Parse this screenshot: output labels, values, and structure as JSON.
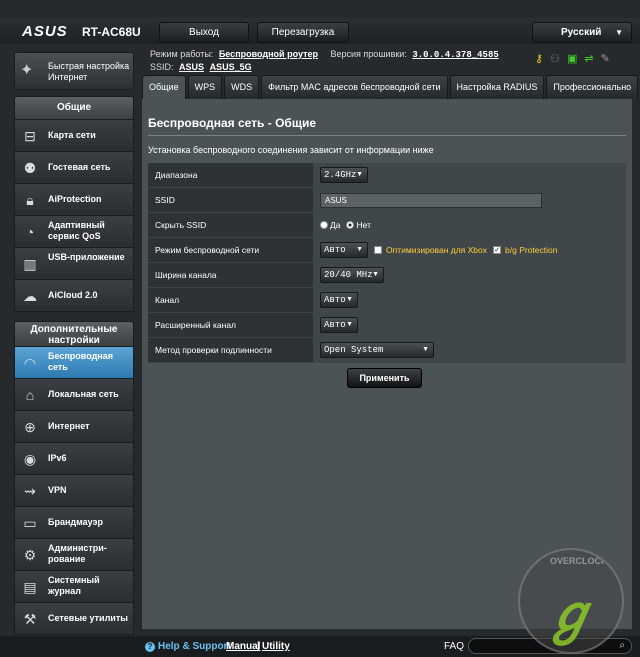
{
  "header": {
    "logo": "ASUS",
    "model": "RT-AC68U",
    "logout_label": "Выход",
    "reboot_label": "Перезагрузка",
    "language": "Русский"
  },
  "status": {
    "mode_label": "Режим работы:",
    "mode_value": "Беспроводной роутер",
    "fw_label": "Версия прошивки:",
    "fw_value": "3.0.0.4.378_4585",
    "ssid_label": "SSID:",
    "ssid_1": "ASUS",
    "ssid_2": "ASUS_5G"
  },
  "quick_setup": "Быстрая настройка Интернет",
  "sidebar": {
    "general_title": "Общие",
    "general_items": [
      {
        "label": "Карта сети",
        "icon": "network-map-icon"
      },
      {
        "label": "Гостевая сеть",
        "icon": "guest-network-icon"
      },
      {
        "label": "AiProtection",
        "icon": "lock-icon"
      },
      {
        "label": "Адаптивный сервис QoS",
        "icon": "qos-gauge-icon"
      },
      {
        "label": "USB-приложение",
        "icon": "usb-icon"
      },
      {
        "label": "AiCloud 2.0",
        "icon": "cloud-icon"
      }
    ],
    "advanced_title": "Дополнительные настройки",
    "advanced_items": [
      {
        "label": "Беспроводная сеть",
        "icon": "wifi-icon"
      },
      {
        "label": "Локальная сеть",
        "icon": "home-icon"
      },
      {
        "label": "Интернет",
        "icon": "globe-icon"
      },
      {
        "label": "IPv6",
        "icon": "ipv6-icon"
      },
      {
        "label": "VPN",
        "icon": "vpn-icon"
      },
      {
        "label": "Брандмауэр",
        "icon": "firewall-icon"
      },
      {
        "label": "Администри-рование",
        "icon": "admin-icon"
      },
      {
        "label": "Системный журнал",
        "icon": "log-icon"
      },
      {
        "label": "Сетевые утилиты",
        "icon": "tools-icon"
      }
    ]
  },
  "tabs": [
    "Общие",
    "WPS",
    "WDS",
    "Фильтр MAC адресов беспроводной сети",
    "Настройка RADIUS",
    "Профессионально"
  ],
  "page": {
    "title": "Беспроводная сеть - Общие",
    "description": "Установка беспроводного соединения зависит от информации ниже"
  },
  "form": {
    "band_label": "Диапазона",
    "band_value": "2.4GHz",
    "ssid_label": "SSID",
    "ssid_value": "ASUS",
    "hide_ssid_label": "Скрыть SSID",
    "hide_yes": "Да",
    "hide_no": "Нет",
    "mode_label": "Режим беспроводной сети",
    "mode_value": "Авто",
    "xbox_label": "Оптимизирован для Xbox",
    "bg_label": "b/g Protection",
    "width_label": "Ширина канала",
    "width_value": "20/40 MHz",
    "channel_label": "Канал",
    "channel_value": "Авто",
    "ext_channel_label": "Расширенный канал",
    "ext_channel_value": "Авто",
    "auth_label": "Метод проверки подлинности",
    "auth_value": "Open System"
  },
  "apply_label": "Применить",
  "footer": {
    "help": "Help & Support",
    "manual": "Manual",
    "utility": "Utility",
    "sep": "|",
    "faq": "FAQ"
  }
}
